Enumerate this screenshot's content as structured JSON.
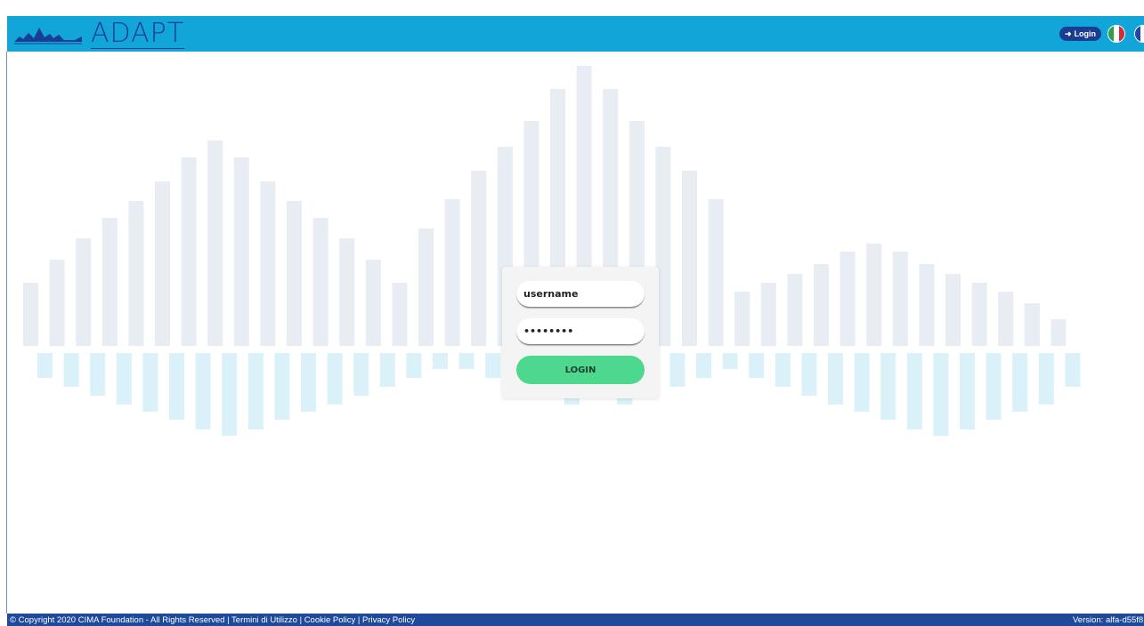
{
  "header": {
    "logo_text": "ADAPT",
    "login_label": "Login",
    "login_icon": "sign-in-icon",
    "languages": [
      {
        "name": "italian-flag",
        "colors": [
          "#2e9e47",
          "#ffffff",
          "#d62b34"
        ]
      },
      {
        "name": "french-flag",
        "colors": [
          "#2446a8",
          "#ffffff",
          "#e8303b"
        ]
      }
    ]
  },
  "login_form": {
    "username_value": "username",
    "password_value": "••••••••",
    "login_button": "LOGIN"
  },
  "footer": {
    "copyright": "© Copyright 2020 CIMA Foundation - All Rights Reserved",
    "links": [
      "Termini di Utilizzo",
      "Cookie Policy",
      "Privacy Policy"
    ],
    "version": "Version: alfa-d55f8"
  },
  "colors": {
    "header_bg": "#12a6d8",
    "footer_bg": "#1f4a9c",
    "upper_bars": "#e4e9f1",
    "lower_bars": "#d6f0f8",
    "login_button": "#4dd88e"
  }
}
